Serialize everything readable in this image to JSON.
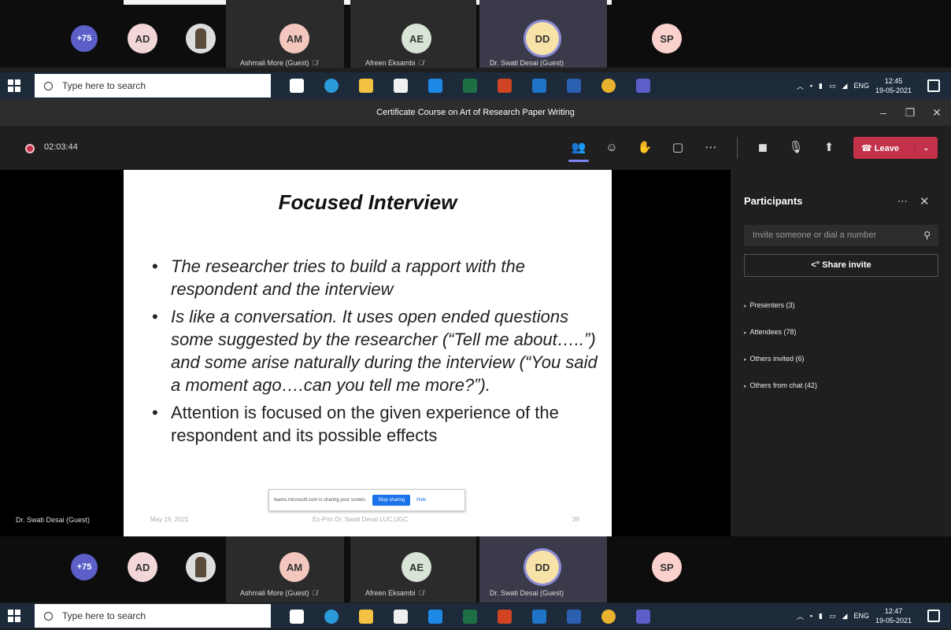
{
  "strip": {
    "more_count": "+75",
    "avatars": [
      {
        "initials": "AD",
        "color": "#f3d6d8"
      },
      {
        "initials": "AM",
        "color": "#f4c7be"
      },
      {
        "initials": "AE",
        "color": "#d8e4d6"
      },
      {
        "initials": "DD",
        "color": "#f7e3a8"
      },
      {
        "initials": "SP",
        "color": "#fbd1cd"
      }
    ],
    "names": {
      "ashmali": "Ashmali More (Guest)",
      "afreen": "Afreen Eksambi",
      "swati": "Dr. Swati Desai (Guest)"
    }
  },
  "taskbar": {
    "search_placeholder": "Type here to search",
    "lang": "ENG",
    "top_time": "12:45",
    "top_date": "19-05-2021",
    "bottom_time": "12:47",
    "bottom_date": "19-05-2021",
    "app_icons": [
      {
        "name": "task-view-icon",
        "color": "#ffffff"
      },
      {
        "name": "edge-icon",
        "color": "#2a9bd8"
      },
      {
        "name": "file-explorer-icon",
        "color": "#f3c242"
      },
      {
        "name": "store-icon",
        "color": "#f0f0f0"
      },
      {
        "name": "mail-icon",
        "color": "#1e88e5"
      },
      {
        "name": "excel-icon",
        "color": "#1d7044"
      },
      {
        "name": "powerpoint-icon",
        "color": "#d04423"
      },
      {
        "name": "outlook-icon",
        "color": "#1f74c7"
      },
      {
        "name": "word-icon",
        "color": "#2b5fb0"
      },
      {
        "name": "chrome-icon",
        "color": "#e8b22e"
      },
      {
        "name": "teams-icon",
        "color": "#5b5fc7"
      }
    ]
  },
  "window": {
    "title": "Certificate Course on Art of Research Paper Writing"
  },
  "toolbar": {
    "timer": "02:03:44",
    "leave_label": "Leave"
  },
  "slide": {
    "title": "Focused Interview",
    "bullets": [
      "The researcher tries to build a rapport with the respondent and the interview",
      "Is like a conversation. It uses open ended questions some suggested by the researcher (“Tell me about…..”) and some arise naturally during the interview (“You said a moment ago….can you tell me more?”).",
      "Attention is focused on the given experience of the respondent and its possible effects"
    ],
    "footer_date": "May 19, 2021",
    "footer_center": "Ex-Prin Dr. Swati Desai LUC,UGC",
    "footer_page": "39",
    "share_text": "teams.microsoft.com is sharing your screen.",
    "stop_label": "Stop sharing",
    "hide_label": "Hide"
  },
  "presenter_name": "Dr. Swati Desai (Guest)",
  "panel": {
    "title": "Participants",
    "invite_placeholder": "Invite someone or dial a number",
    "share_invite": "Share invite",
    "sections": [
      "Presenters (3)",
      "Attendees (78)",
      "Others invited (6)",
      "Others from chat (42)"
    ]
  }
}
